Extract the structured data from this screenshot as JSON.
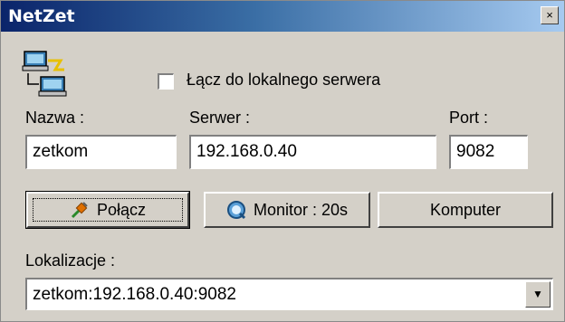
{
  "window": {
    "title": "NetZet",
    "close_glyph": "×"
  },
  "app_icon": "network-computers-icon",
  "local_server": {
    "label": "Łącz do lokalnego serwera",
    "checked": false
  },
  "fields": {
    "name_label": "Nazwa :",
    "name_value": "zetkom",
    "server_label": "Serwer :",
    "server_value": "192.168.0.40",
    "port_label": "Port :",
    "port_value": "9082"
  },
  "buttons": {
    "connect": {
      "label": "Połącz",
      "icon": "plug-icon"
    },
    "monitor": {
      "label": "Monitor : 20s",
      "icon": "magnifier-icon"
    },
    "computer": {
      "label": "Komputer"
    }
  },
  "locations": {
    "label": "Lokalizacje :",
    "selected": "zetkom:192.168.0.40:9082",
    "arrow": "▼"
  }
}
